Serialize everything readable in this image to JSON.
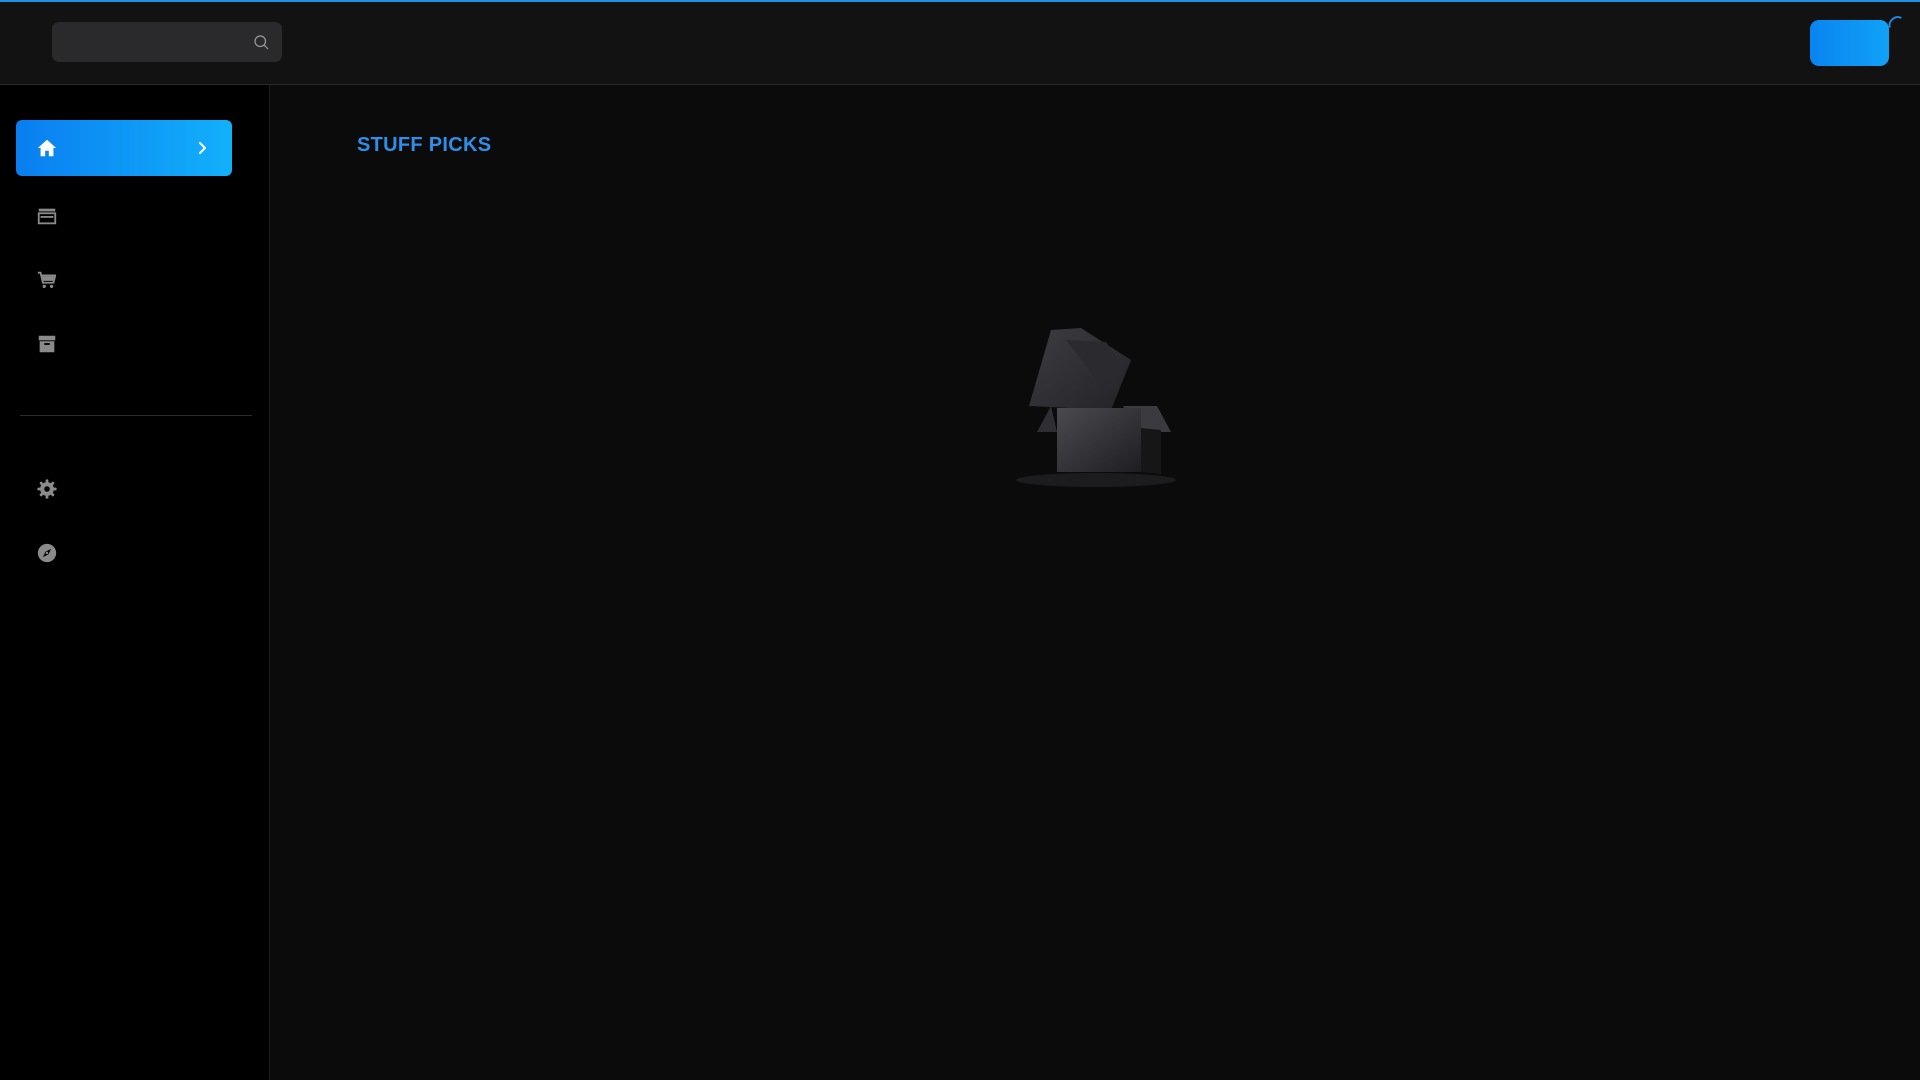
{
  "search": {
    "value": "",
    "placeholder": "",
    "icon": "search-icon"
  },
  "header": {
    "user_button_label": "",
    "loading_icon": "spinner-icon"
  },
  "sidebar": {
    "items": [
      {
        "name": "home",
        "icon": "home-icon",
        "active": true
      },
      {
        "name": "store",
        "icon": "store-icon",
        "active": false
      },
      {
        "name": "cart",
        "icon": "cart-icon",
        "active": false
      },
      {
        "name": "archive",
        "icon": "archive-icon",
        "active": false
      },
      {
        "name": "settings",
        "icon": "gear-icon",
        "active": false
      },
      {
        "name": "explore",
        "icon": "compass-icon",
        "active": false
      }
    ]
  },
  "main": {
    "section_title": "STUFF PICKS",
    "empty_state_icon": "open-box-icon"
  },
  "colors": {
    "accent": "#1c8fe6",
    "accent_gradient_start": "#0a7ef0",
    "accent_gradient_end": "#12b0fb",
    "background": "#0b0b0c",
    "sidebar_background": "#000000",
    "topbar_background": "#121212"
  }
}
